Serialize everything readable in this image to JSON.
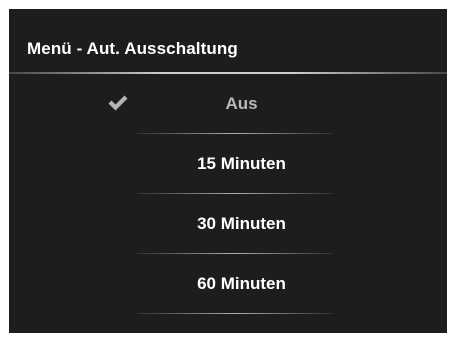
{
  "menu": {
    "title": "Menü - Aut. Ausschaltung",
    "options": [
      {
        "label": "Aus",
        "selected": true
      },
      {
        "label": "15 Minuten",
        "selected": false
      },
      {
        "label": "30 Minuten",
        "selected": false
      },
      {
        "label": "60 Minuten",
        "selected": false
      }
    ]
  },
  "icons": {
    "selected_indicator": "checkmark-icon"
  },
  "colors": {
    "background": "#1d1d1d",
    "text": "#ffffff",
    "selected_text": "#b9b9b9",
    "checkmark": "#b5b5b5",
    "divider": "#d7d7d7"
  }
}
